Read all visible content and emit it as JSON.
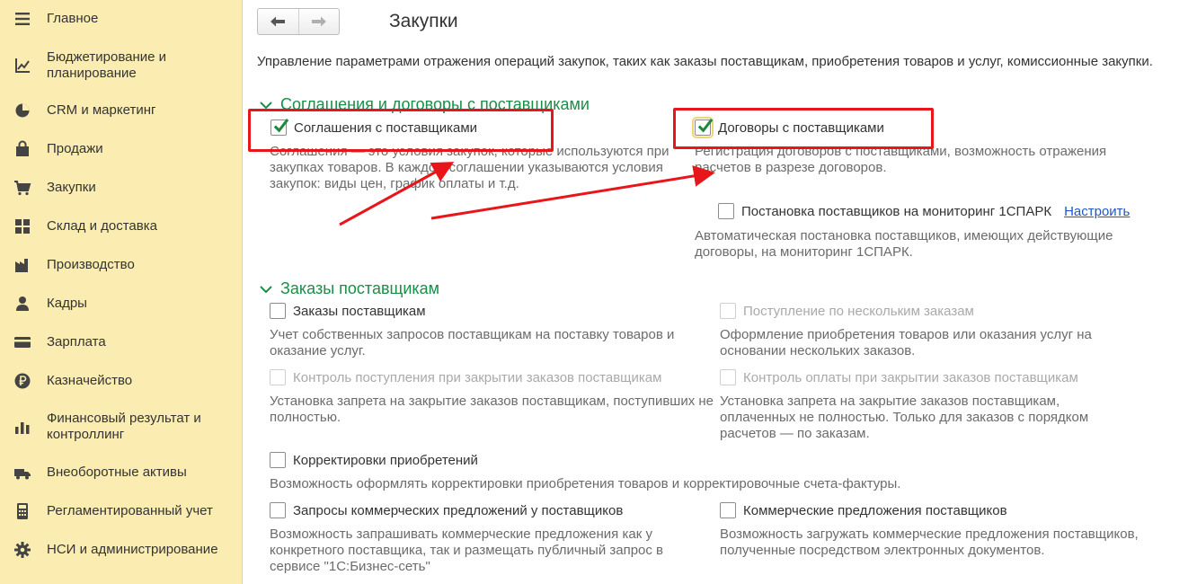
{
  "sidebar": {
    "items": [
      {
        "label": "Главное",
        "icon": "menu-icon"
      },
      {
        "label": "Бюджетирование и планирование",
        "icon": "budget-chart-icon"
      },
      {
        "label": "CRM и маркетинг",
        "icon": "pie-chart-icon"
      },
      {
        "label": "Продажи",
        "icon": "shopping-bag-icon"
      },
      {
        "label": "Закупки",
        "icon": "shopping-cart-icon"
      },
      {
        "label": "Склад и доставка",
        "icon": "warehouse-grid-icon"
      },
      {
        "label": "Производство",
        "icon": "factory-icon"
      },
      {
        "label": "Кадры",
        "icon": "person-icon"
      },
      {
        "label": "Зарплата",
        "icon": "card-icon"
      },
      {
        "label": "Казначейство",
        "icon": "ruble-coin-icon"
      },
      {
        "label": "Финансовый результат и контроллинг",
        "icon": "bar-chart-icon"
      },
      {
        "label": "Внеоборотные активы",
        "icon": "truck-icon"
      },
      {
        "label": "Регламентированный учет",
        "icon": "calculator-icon"
      },
      {
        "label": "НСИ и администрирование",
        "icon": "gear-icon"
      }
    ]
  },
  "header": {
    "title": "Закупки",
    "back_icon": "arrow-left-icon",
    "forward_icon": "arrow-right-icon"
  },
  "description": "Управление параметрами отражения операций закупок, таких как заказы поставщикам, приобретения товаров и услуг, комиссионные закупки.",
  "section_agreements": {
    "title": "Соглашения и договоры с поставщиками",
    "agreements": {
      "label": "Соглашения с поставщиками",
      "checked": true,
      "hint": "Соглашения — это условия закупок, которые используются при закупках товаров. В каждом соглашении указываются условия закупок: виды цен, график оплаты и т.д."
    },
    "contracts": {
      "label": "Договоры с поставщиками",
      "checked": true,
      "hint": "Регистрация договоров с поставщиками, возможность отражения расчетов в разрезе договоров."
    },
    "monitoring": {
      "label": "Постановка поставщиков на мониторинг 1СПАРК",
      "checked": false,
      "link": "Настроить",
      "hint": "Автоматическая постановка поставщиков, имеющих действующие договоры, на мониторинг 1СПАРК."
    }
  },
  "section_orders": {
    "title": "Заказы поставщикам",
    "orders": {
      "label": "Заказы поставщикам",
      "checked": false,
      "hint": "Учет собственных запросов поставщикам на поставку товаров и оказание услуг."
    },
    "multi_orders": {
      "label": "Поступление по нескольким заказам",
      "checked": false,
      "enabled": false,
      "hint": "Оформление приобретения товаров или оказания услуг на основании нескольких заказов."
    },
    "receipt_control": {
      "label": "Контроль поступления при закрытии заказов поставщикам",
      "checked": false,
      "enabled": false,
      "hint": "Установка запрета на закрытие заказов поставщикам, поступивших не полностью."
    },
    "payment_control": {
      "label": "Контроль оплаты при закрытии заказов поставщикам",
      "checked": false,
      "enabled": false,
      "hint": "Установка запрета на закрытие заказов поставщикам, оплаченных не полностью. Только для заказов с порядком расчетов — по заказам."
    },
    "adjustments": {
      "label": "Корректировки приобретений",
      "checked": false,
      "hint": "Возможность оформлять корректировки приобретения товаров и корректировочные счета-фактуры."
    },
    "rfq": {
      "label": "Запросы коммерческих предложений у поставщиков",
      "checked": false,
      "hint": "Возможность запрашивать коммерческие предложения как у конкретного поставщика, так и размещать публичный запрос в сервисе \"1С:Бизнес-сеть\""
    },
    "offers": {
      "label": "Коммерческие предложения поставщиков",
      "checked": false,
      "hint": "Возможность загружать коммерческие предложения поставщиков, полученные посредством электронных документов."
    }
  },
  "annotation_color": "#e8151a",
  "accent_green": "#1a8e48",
  "sidebar_bg": "#fbedb1"
}
